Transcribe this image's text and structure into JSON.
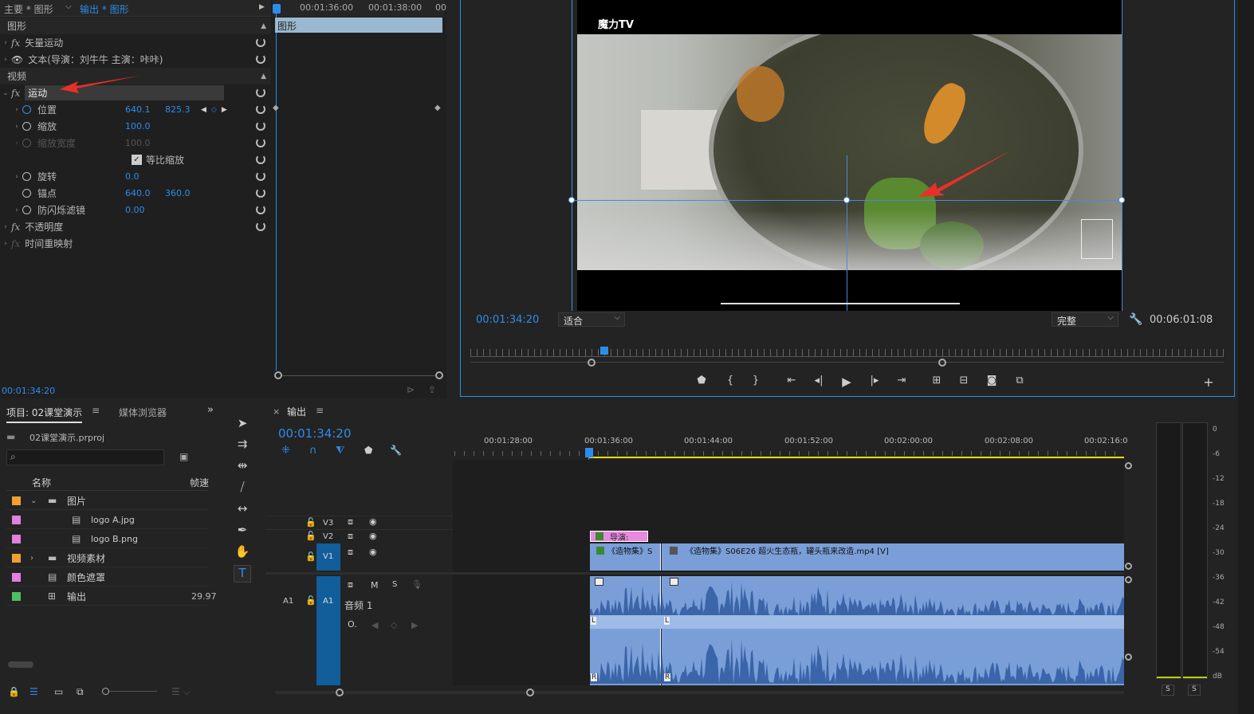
{
  "effect_controls": {
    "tab_master": "主要 * 图形",
    "tab_sequence": "输出 * 图形",
    "time_1": "00:01:36:00",
    "time_2": "00:01:38:00",
    "time_3": "00",
    "section_graphic": "图形",
    "vector_motion": "矢量运动",
    "text_layer": "文本(导演：刘牛牛 主演：咔咔)",
    "section_video": "视频",
    "clip_label": "图形",
    "motion": "运动",
    "position_label": "位置",
    "position_x": "640.1",
    "position_y": "825.3",
    "scale_label": "缩放",
    "scale_val": "100.0",
    "scale_width_label": "缩放宽度",
    "scale_width_val": "100.0",
    "uniform_scale": "等比缩放",
    "rotation_label": "旋转",
    "rotation_val": "0.0",
    "anchor_label": "锚点",
    "anchor_x": "640.0",
    "anchor_y": "360.0",
    "antiflicker_label": "防闪烁滤镜",
    "antiflicker_val": "0.00",
    "opacity_label": "不透明度",
    "time_remap_label": "时间重映射",
    "current_time": "00:01:34:20"
  },
  "program_monitor": {
    "watermark": "魔力TV",
    "timecode": "00:01:34:20",
    "fit_select": "适合",
    "quality_select": "完整",
    "duration": "00:06:01:08"
  },
  "project": {
    "tab_project": "项目: 02课堂演示",
    "tab_media": "媒体浏览器",
    "filename": "02课堂演示.prproj",
    "col_name": "名称",
    "col_fps": "帧速",
    "items": [
      {
        "label": "图片",
        "color": "#f0a030",
        "type": "folder",
        "indent": 0,
        "expanded": true
      },
      {
        "label": "logo A.jpg",
        "color": "#e080e0",
        "type": "file",
        "indent": 1,
        "expanded": false
      },
      {
        "label": "logo B.png",
        "color": "#e080e0",
        "type": "file",
        "indent": 1,
        "expanded": false
      },
      {
        "label": "视频素材",
        "color": "#f0a030",
        "type": "folder",
        "indent": 0,
        "expanded": false
      },
      {
        "label": "颜色遮罩",
        "color": "#e080e0",
        "type": "file",
        "indent": 0,
        "expanded": false
      },
      {
        "label": "输出",
        "color": "#4cc060",
        "type": "sequence",
        "indent": 0,
        "expanded": false,
        "fps": "29.97"
      }
    ]
  },
  "timeline": {
    "tab": "输出",
    "timecode": "00:01:34:20",
    "ruler": [
      "00:01:28:00",
      "00:01:36:00",
      "00:01:44:00",
      "00:01:52:00",
      "00:02:00:00",
      "00:02:08:00",
      "00:02:16:0"
    ],
    "v3": "V3",
    "v2": "V2",
    "v1": "V1",
    "a1": "A1",
    "audio1": "音频 1",
    "clip_v2": "导演:",
    "clip_v1a": "《造物集》S",
    "clip_v1b": "《造物集》S06E26 超火生态瓶，罐头瓶来改造.mp4 [V]",
    "m": "M",
    "s": "S"
  },
  "meters": {
    "scale": [
      "0",
      "-6",
      "-12",
      "-18",
      "-24",
      "-30",
      "-36",
      "-42",
      "-48",
      "-54",
      "dB"
    ],
    "solo": "S"
  }
}
